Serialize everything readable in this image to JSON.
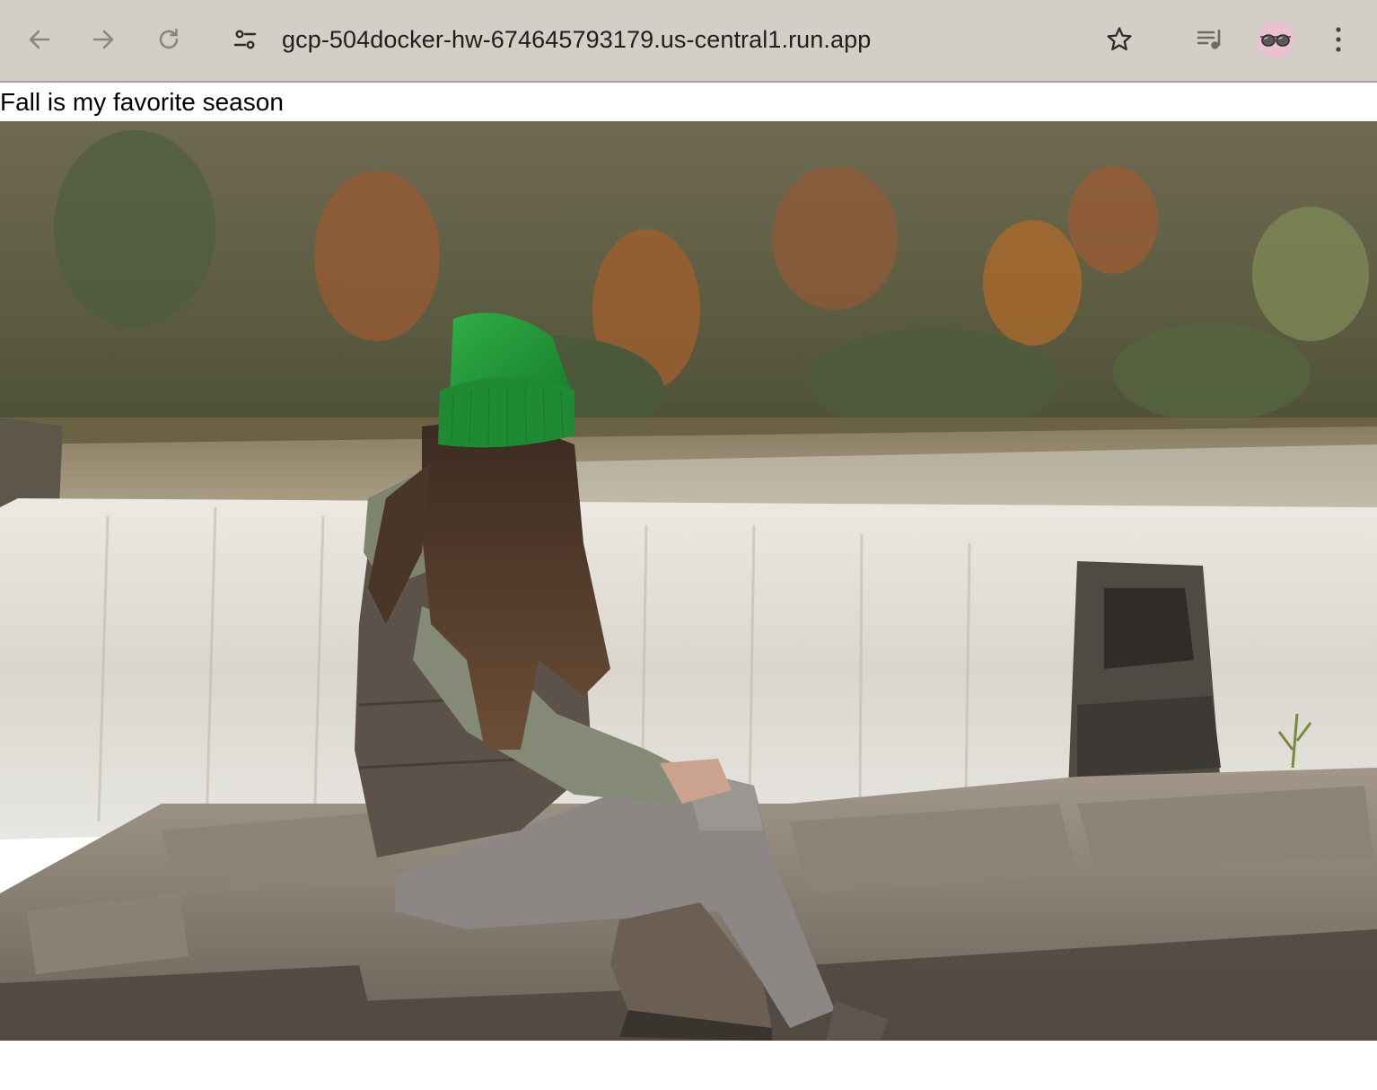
{
  "browser": {
    "address_bar": {
      "url": "gcp-504docker-hw-674645793179.us-central1.run.app"
    },
    "icons": {
      "back": "arrow-left",
      "forward": "arrow-right",
      "reload": "circular-arrow",
      "site_info": "tune-sliders",
      "bookmark": "star-outline",
      "media": "playlist-music",
      "profile": "sunglasses-avatar",
      "menu": "vertical-ellipsis"
    },
    "colors": {
      "toolbar_bg": "#d3cec6",
      "avatar_bg": "#ecc1cf"
    }
  },
  "page": {
    "text": "Fall is my favorite season",
    "image": {
      "subject": "person-in-green-beanie-sitting-on-stone-wall-by-waterfall"
    }
  }
}
